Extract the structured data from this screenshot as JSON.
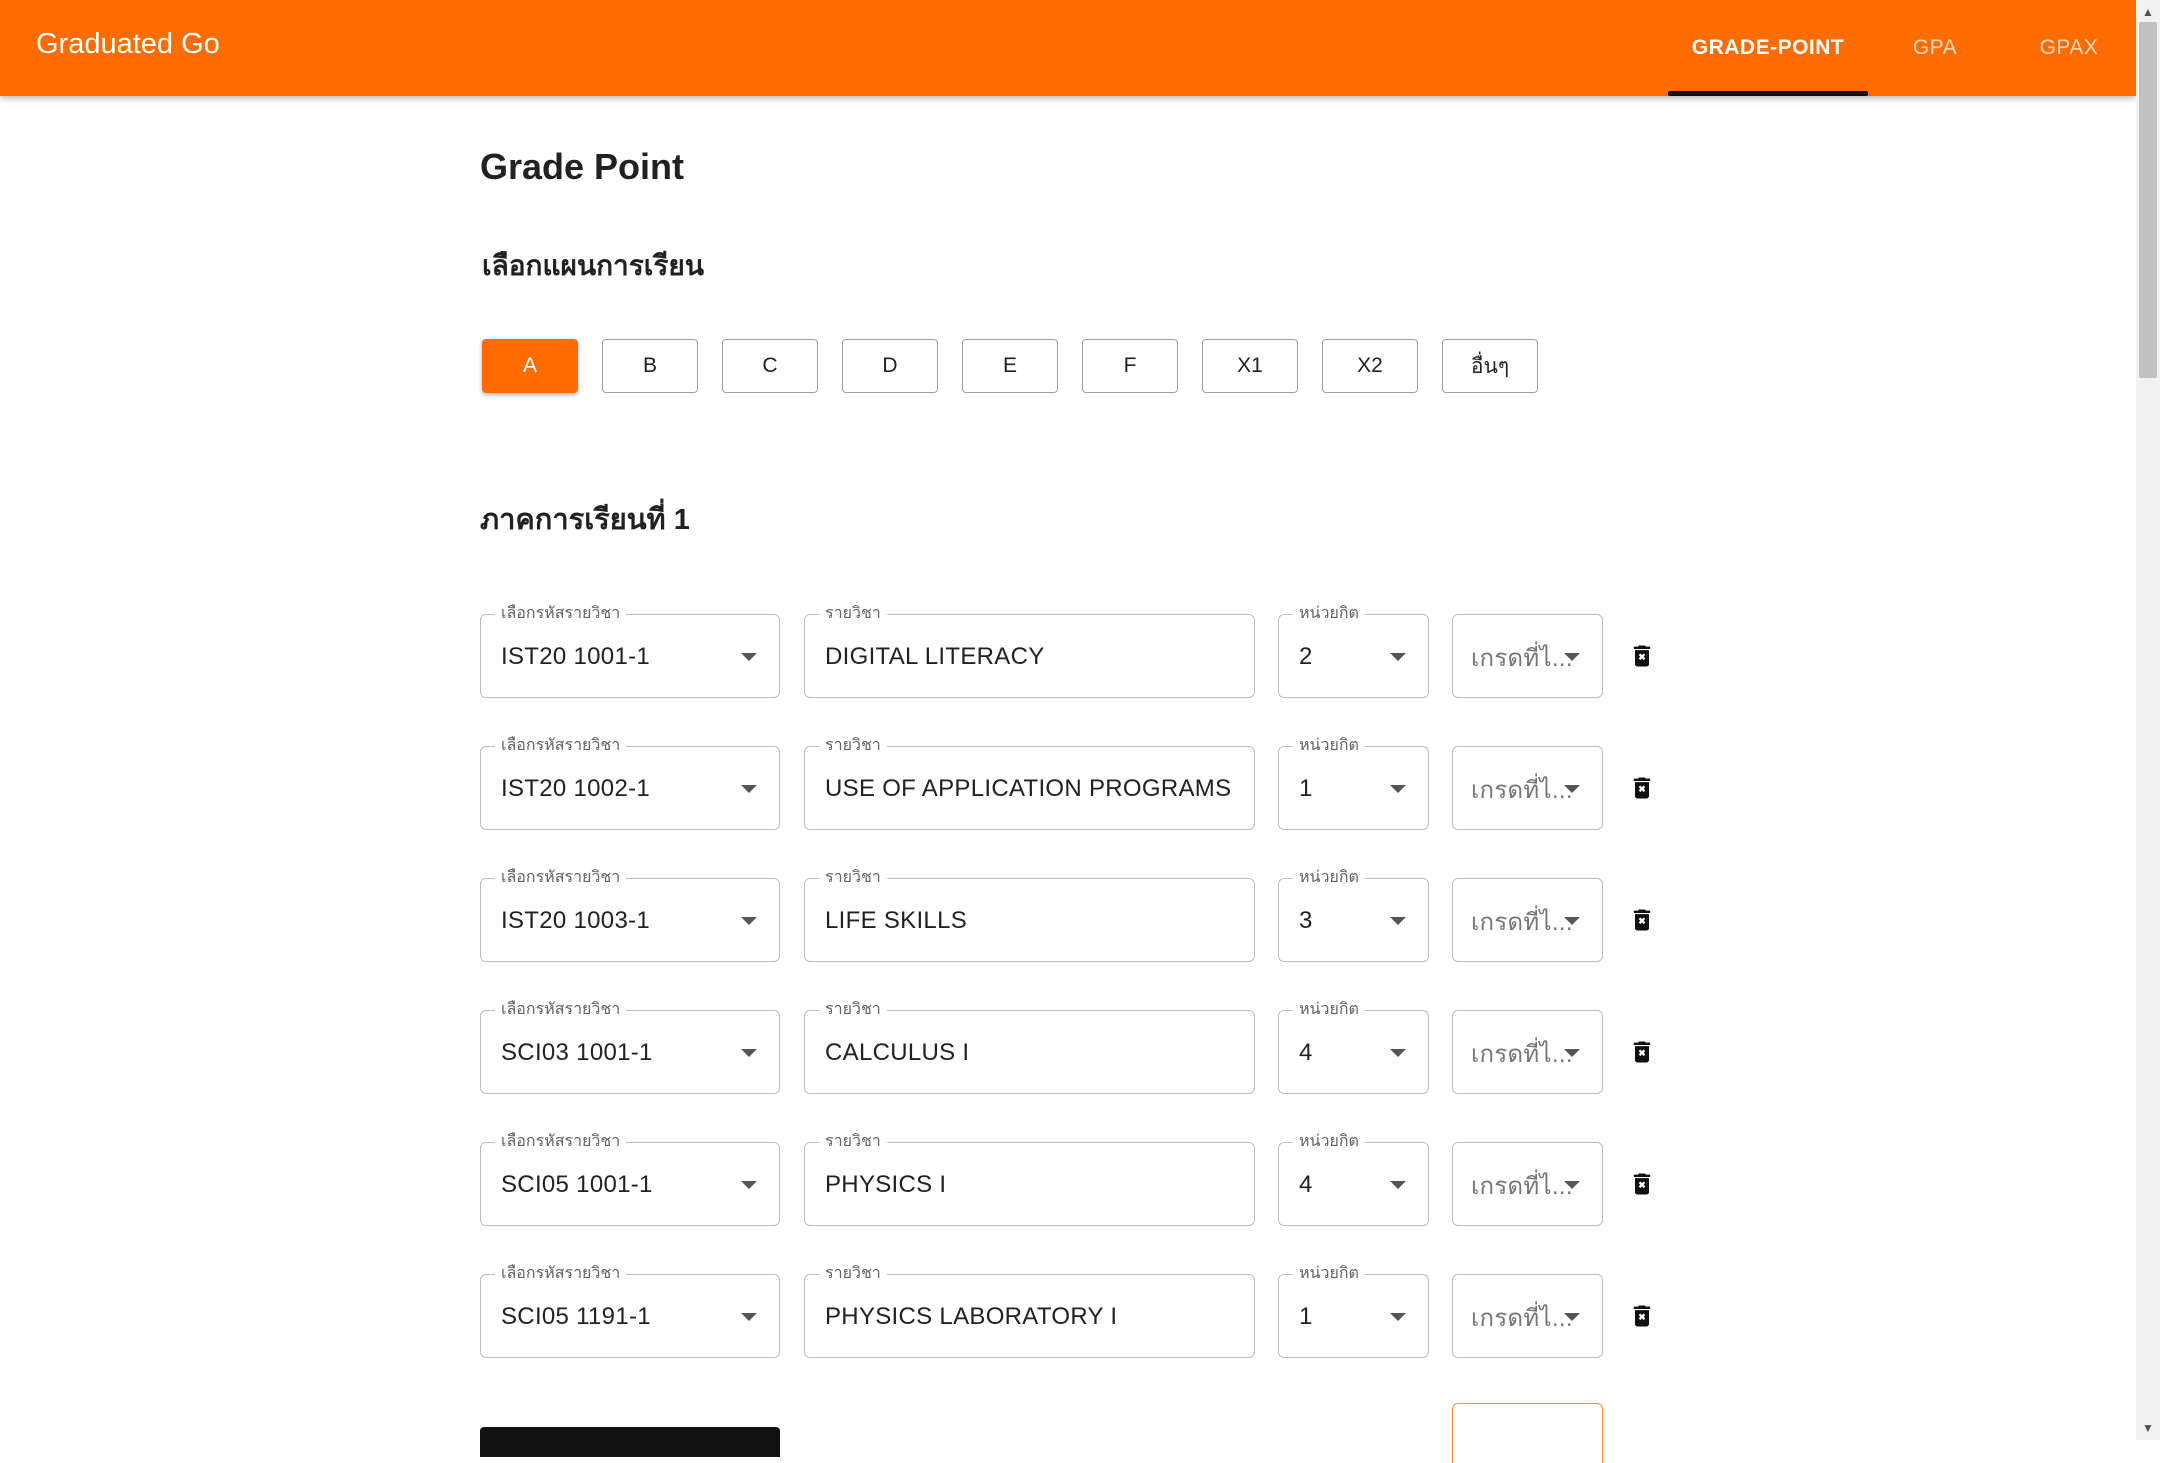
{
  "app": {
    "title": "Graduated Go"
  },
  "nav": {
    "tabs": [
      {
        "label": "GRADE-POINT",
        "active": true
      },
      {
        "label": "GPA",
        "active": false
      },
      {
        "label": "GPAX",
        "active": false
      }
    ]
  },
  "page": {
    "title": "Grade Point",
    "plan_label": "เลือกแผนการเรียน",
    "plans": [
      {
        "label": "A",
        "selected": true
      },
      {
        "label": "B",
        "selected": false
      },
      {
        "label": "C",
        "selected": false
      },
      {
        "label": "D",
        "selected": false
      },
      {
        "label": "E",
        "selected": false
      },
      {
        "label": "F",
        "selected": false
      },
      {
        "label": "X1",
        "selected": false
      },
      {
        "label": "X2",
        "selected": false
      },
      {
        "label": "อื่นๆ",
        "selected": false
      }
    ],
    "term_label": "ภาคการเรียนที่ 1"
  },
  "form_labels": {
    "course_code": "เลือกรหัสรายวิชา",
    "course_name": "รายวิชา",
    "credits": "หน่วยกิต",
    "grade_placeholder": "เกรดที่ไ..."
  },
  "courses": [
    {
      "code": "IST20 1001-1",
      "name": "DIGITAL LITERACY",
      "credits": "2"
    },
    {
      "code": "IST20 1002-1",
      "name": "USE OF APPLICATION PROGRAMS",
      "credits": "1"
    },
    {
      "code": "IST20 1003-1",
      "name": "LIFE SKILLS",
      "credits": "3"
    },
    {
      "code": "SCI03 1001-1",
      "name": "CALCULUS I",
      "credits": "4"
    },
    {
      "code": "SCI05 1001-1",
      "name": "PHYSICS I",
      "credits": "4"
    },
    {
      "code": "SCI05 1191-1",
      "name": "PHYSICS LABORATORY I",
      "credits": "1"
    }
  ],
  "colors": {
    "brand": "#ff6d00",
    "tab_indicator": "#111111",
    "border": "#bdbdbd"
  },
  "icons": {
    "delete": "trash-x-icon",
    "dropdown": "caret-down-icon"
  }
}
